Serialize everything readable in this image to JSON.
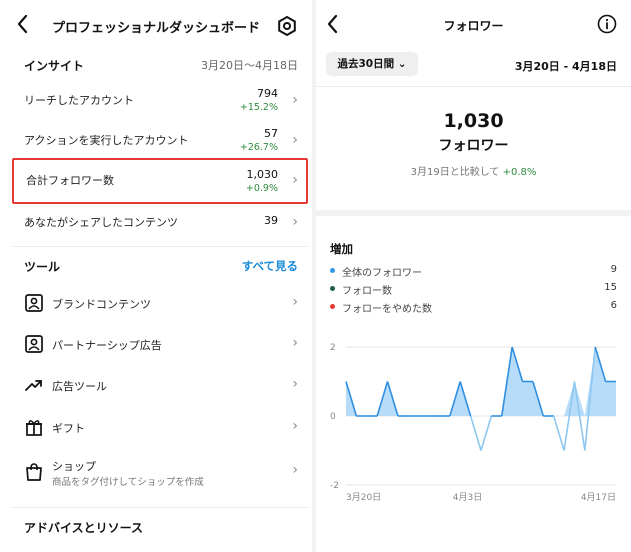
{
  "left": {
    "title": "プロフェッショナルダッシュボード",
    "insights": {
      "heading": "インサイト",
      "date_range": "3月20日〜4月18日",
      "rows": [
        {
          "label": "リーチしたアカウント",
          "value": "794",
          "change": "+15.2%"
        },
        {
          "label": "アクションを実行したアカウント",
          "value": "57",
          "change": "+26.7%"
        },
        {
          "label": "合計フォロワー数",
          "value": "1,030",
          "change": "+0.9%"
        },
        {
          "label": "あなたがシェアしたコンテンツ",
          "value": "39",
          "change": ""
        }
      ]
    },
    "tools": {
      "heading": "ツール",
      "see_all": "すべて見る",
      "items": [
        {
          "label": "ブランドコンテンツ",
          "sub": "",
          "icon": "brand-content-icon"
        },
        {
          "label": "パートナーシップ広告",
          "sub": "",
          "icon": "partnership-ad-icon"
        },
        {
          "label": "広告ツール",
          "sub": "",
          "icon": "trending-up-icon"
        },
        {
          "label": "ギフト",
          "sub": "",
          "icon": "gift-icon"
        },
        {
          "label": "ショップ",
          "sub": "商品をタグ付けしてショップを作成",
          "icon": "shopping-bag-icon"
        }
      ]
    },
    "advice_heading": "アドバイスとリソース"
  },
  "right": {
    "title": "フォロワー",
    "period_button": "過去30日間 ⌄",
    "period_range": "3月20日 - 4月18日",
    "total_value": "1,030",
    "total_label": "フォロワー",
    "compare_prefix": "3月19日と比較して",
    "compare_value": "+0.8%",
    "increase_heading": "増加",
    "legend": [
      {
        "label": "全体のフォロワー",
        "value": "9",
        "color": "#2f9be8"
      },
      {
        "label": "フォロー数",
        "value": "15",
        "color": "#1b5e40"
      },
      {
        "label": "フォローをやめた数",
        "value": "6",
        "color": "#e53935"
      }
    ]
  },
  "colors": {
    "accent": "#1a8ad9",
    "positive": "#2e8b3e",
    "highlight_border": "#e53935",
    "series_fill": "#b7dcfa",
    "series_line": "#2f8fe0",
    "negative_line": "#8ec7f0"
  },
  "chart_data": {
    "type": "area",
    "x_ticks": [
      "3月20日",
      "4月3日",
      "4月17日"
    ],
    "y_ticks": [
      "2",
      "0",
      "-2"
    ],
    "ylim": [
      -2,
      2
    ],
    "series": [
      {
        "name": "全体のフォロワー",
        "values": [
          1,
          0,
          0,
          0,
          1,
          0,
          0,
          0,
          0,
          0,
          0,
          1,
          0,
          -1,
          0,
          0,
          2,
          1,
          1,
          0,
          0,
          -1,
          1,
          -1,
          2,
          1,
          1
        ]
      }
    ]
  }
}
